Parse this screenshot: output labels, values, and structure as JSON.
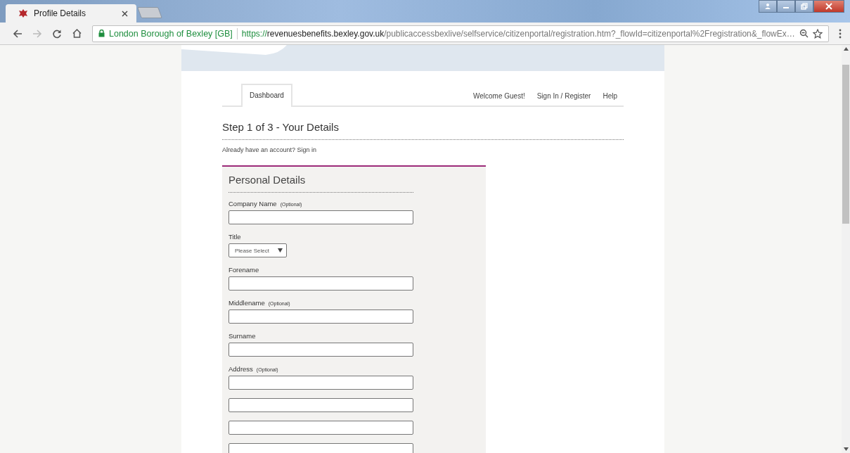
{
  "browser": {
    "tab_title": "Profile Details",
    "site_identity": "London Borough of Bexley [GB]",
    "url_scheme": "https://",
    "url_host": "revenuesbenefits.bexley.gov.uk",
    "url_path": "/publicaccessbexlive/selfservice/citizenportal/registration.htm?_flowId=citizenportal%2Fregistration&_flowEx…"
  },
  "nav": {
    "tabs": [
      {
        "label": "Dashboard",
        "selected": true
      }
    ],
    "welcome": "Welcome Guest!",
    "links": [
      "Sign In / Register",
      "Help"
    ]
  },
  "page_title": "Step 1 of 3 - Your Details",
  "account_prompt": "Already have an account? Sign in",
  "section_title": "Personal Details",
  "fields": [
    {
      "kind": "text",
      "label": "Company Name",
      "note": "(Optional)"
    },
    {
      "kind": "select",
      "label": "Title",
      "value": "Please Select"
    },
    {
      "kind": "text",
      "label": "Forename"
    },
    {
      "kind": "text",
      "label": "Middlename",
      "note": "(Optional)"
    },
    {
      "kind": "text",
      "label": "Surname"
    },
    {
      "kind": "text",
      "label": "Address",
      "note": "(Optional)"
    },
    {
      "kind": "text"
    },
    {
      "kind": "text"
    },
    {
      "kind": "text"
    }
  ]
}
